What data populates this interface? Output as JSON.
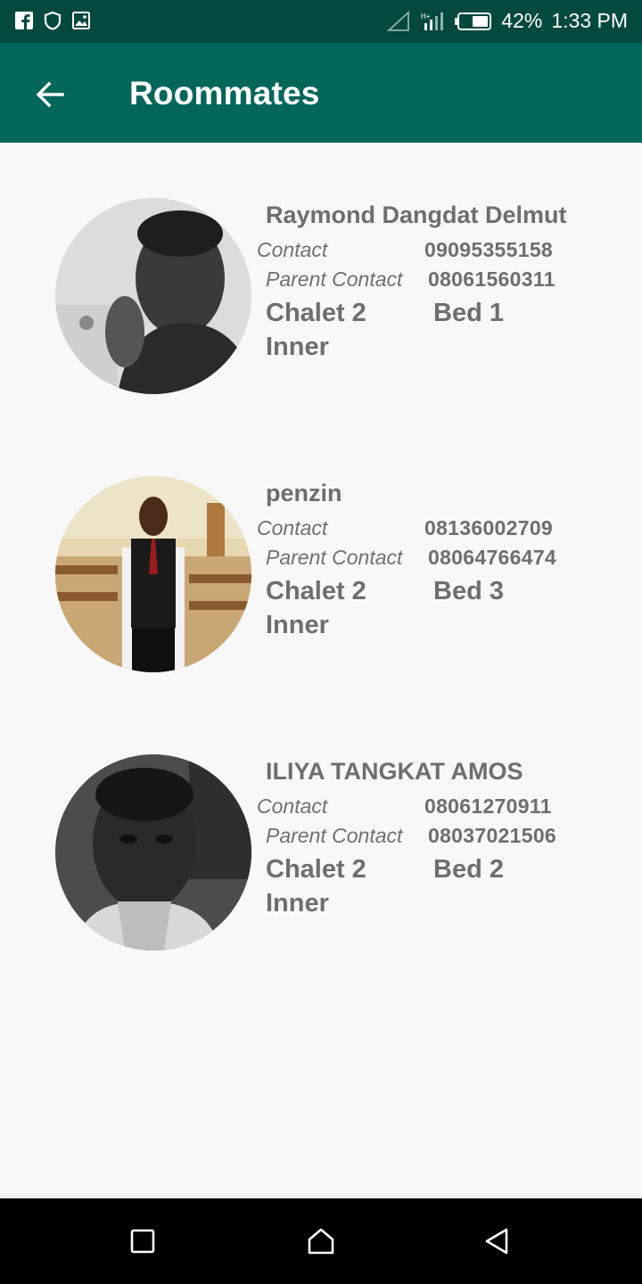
{
  "status_bar": {
    "battery_percent": "42%",
    "time": "1:33 PM",
    "icons_left": [
      "facebook-icon",
      "shield-icon",
      "image-icon"
    ],
    "icons_right": [
      "signal-icon",
      "data-signal-icon",
      "battery-icon"
    ]
  },
  "app_bar": {
    "title": "Roommates",
    "back_icon": "arrow-left-icon"
  },
  "labels": {
    "contact": "Contact",
    "parent_contact": "Parent Contact"
  },
  "roommates": [
    {
      "name": "Raymond Dangdat Delmut",
      "contact": "09095355158",
      "parent_contact": "08061560311",
      "chalet": "Chalet 2",
      "section": "Inner",
      "bed": "Bed 1"
    },
    {
      "name": "penzin",
      "contact": "08136002709",
      "parent_contact": "08064766474",
      "chalet": "Chalet 2",
      "section": "Inner",
      "bed": "Bed 3"
    },
    {
      "name": "ILIYA TANGKAT AMOS",
      "contact": "08061270911",
      "parent_contact": "08037021506",
      "chalet": "Chalet 2",
      "section": "Inner",
      "bed": "Bed 2"
    }
  ],
  "nav_bar": {
    "icons": [
      "square-recents-icon",
      "home-icon",
      "triangle-back-icon"
    ]
  },
  "colors": {
    "status_bar": "#03493f",
    "app_bar": "#03665a",
    "text_gray": "#6e6e6e",
    "background": "#f8f8f8"
  }
}
